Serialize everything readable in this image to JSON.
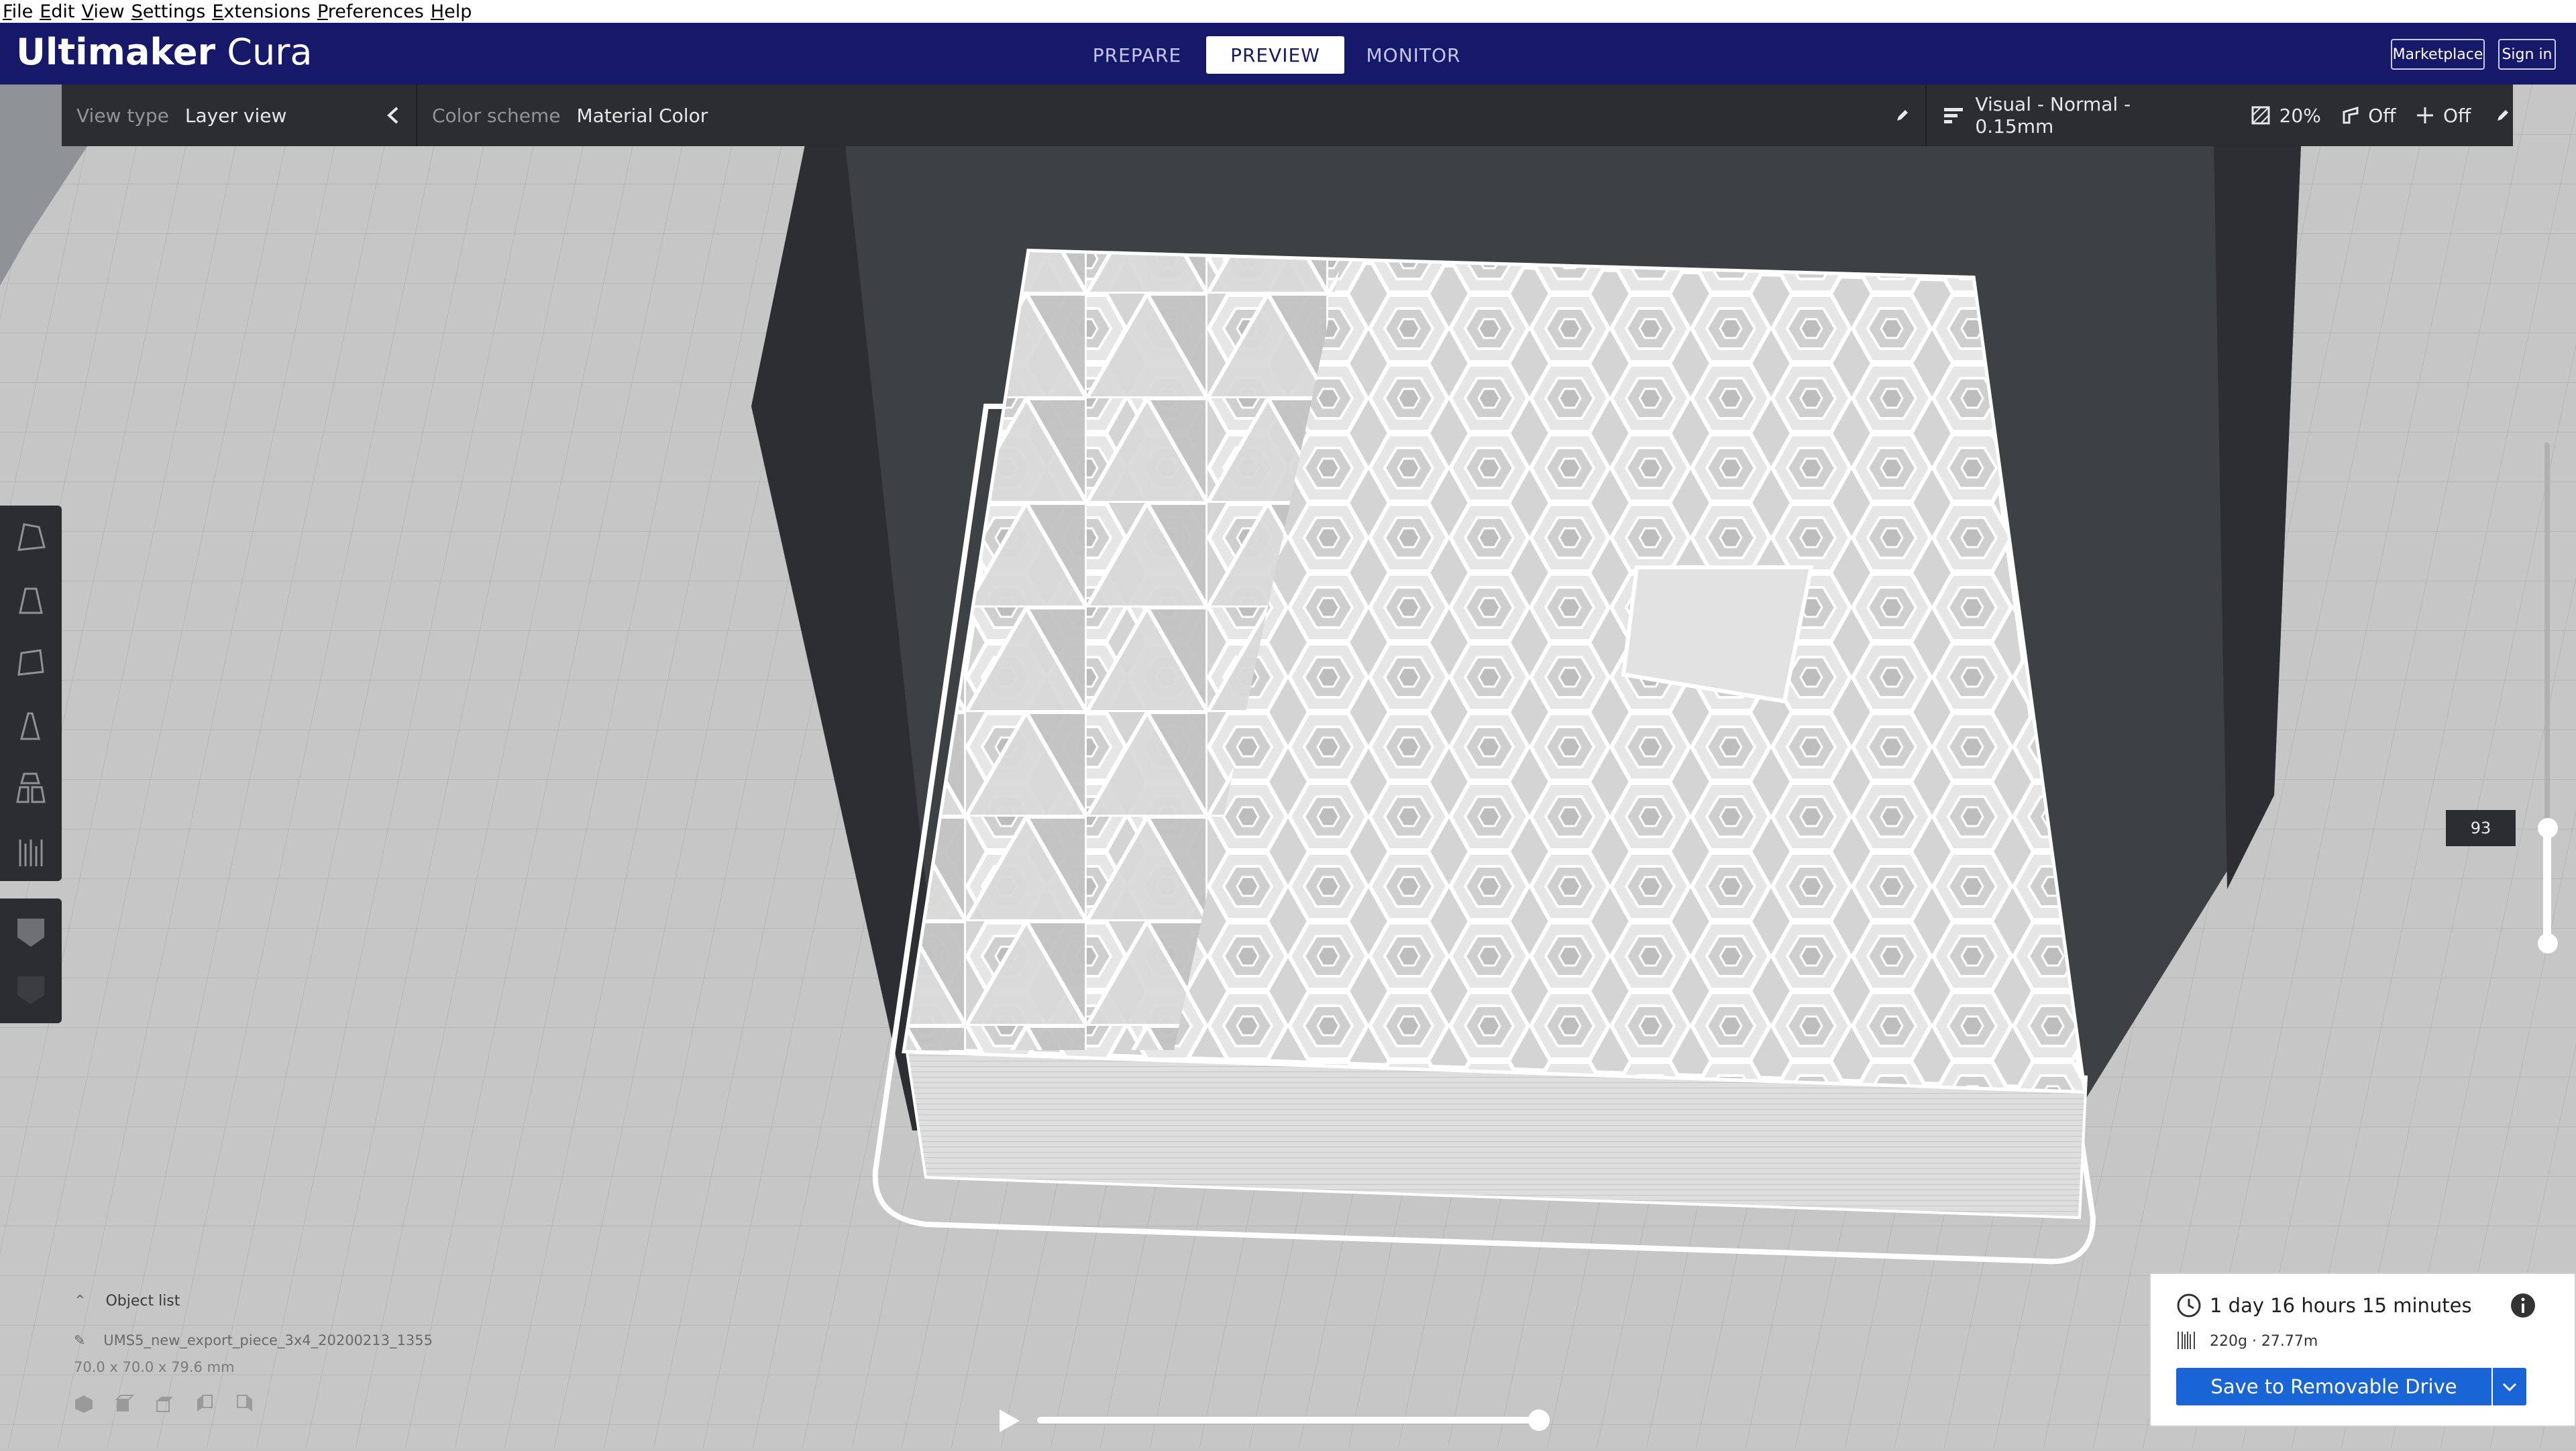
{
  "menu": [
    "File",
    "Edit",
    "View",
    "Settings",
    "Extensions",
    "Preferences",
    "Help"
  ],
  "app": {
    "brand_bold": "Ultimaker",
    "brand_light": "Cura"
  },
  "stages": [
    {
      "label": "PREPARE",
      "active": false
    },
    {
      "label": "PREVIEW",
      "active": true
    },
    {
      "label": "MONITOR",
      "active": false
    }
  ],
  "header_buttons": {
    "marketplace": "Marketplace",
    "signin": "Sign in"
  },
  "toolbar": {
    "view_type_label": "View type",
    "view_type_value": "Layer view",
    "color_scheme_label": "Color scheme",
    "color_scheme_value": "Material Color",
    "profile": "Visual - Normal - 0.15mm",
    "infill": "20%",
    "support": "Off",
    "adhesion": "Off"
  },
  "layer_slider": {
    "current_layer": "93"
  },
  "object_list": {
    "title": "Object list",
    "filename": "UMS5_new_export_piece_3x4_20200213_1355",
    "dimensions": "70.0 x 70.0 x 79.6 mm"
  },
  "playback": {
    "progress": 1.0
  },
  "print_info": {
    "time": "1 day 16 hours 15 minutes",
    "material": "220g · 27.77m",
    "save_label": "Save to Removable Drive"
  },
  "colors": {
    "header": "#16186a",
    "accent": "#1965d8",
    "toolbar": "#2b2d30"
  },
  "icons": [
    "info-icon",
    "clock-icon",
    "spool-icon",
    "pencil-icon",
    "chevron-left-icon",
    "play-icon",
    "chevron-down-icon"
  ]
}
